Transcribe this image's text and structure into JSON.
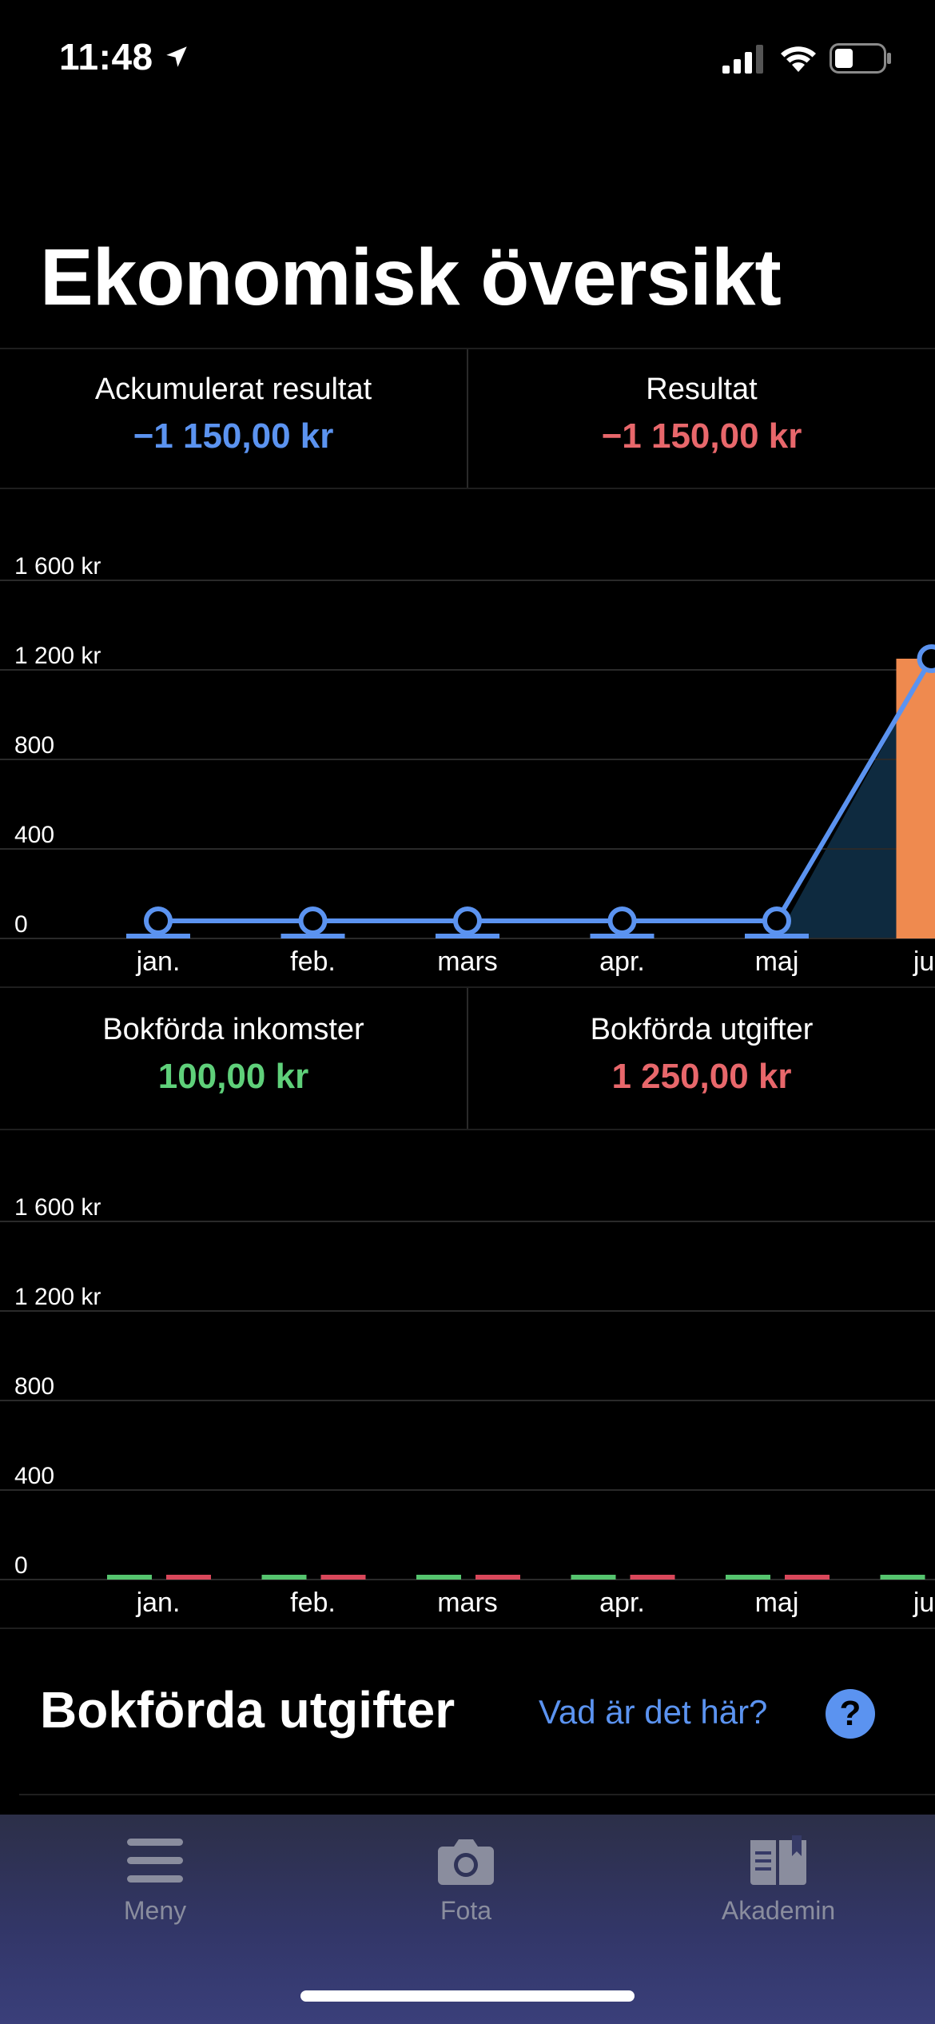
{
  "status_bar": {
    "time": "11:48",
    "icons": [
      "location-arrow-icon",
      "signal-icon",
      "wifi-icon",
      "battery-icon"
    ]
  },
  "page_title": "Ekonomisk översikt",
  "summary": {
    "accumulated_label": "Ackumulerat resultat",
    "accumulated_value": "−1 150,00 kr",
    "result_label": "Resultat",
    "result_value": "−1 150,00 kr"
  },
  "booked": {
    "income_label": "Bokförda inkomster",
    "income_value": "100,00 kr",
    "expenses_label": "Bokförda utgifter",
    "expenses_value": "1 250,00 kr"
  },
  "colors": {
    "accent_blue": "#5b93f0",
    "negative_red": "#e8676b",
    "positive_green": "#5fd07a",
    "bar_orange": "#ef8a4f",
    "expense_bar": "#d9475a",
    "income_bar": "#55c46e"
  },
  "chart_data": [
    {
      "type": "bar",
      "categories": [
        "jan.",
        "feb.",
        "mars",
        "apr.",
        "maj",
        "jun"
      ],
      "y_ticks": [
        "1 600 kr",
        "1 200 kr",
        "800",
        "400",
        "0"
      ],
      "ylim": [
        0,
        1600
      ],
      "series": [
        {
          "type": "bar",
          "values": [
            0,
            0,
            0,
            0,
            0,
            1250
          ]
        },
        {
          "type": "line",
          "values": [
            0,
            0,
            0,
            0,
            0,
            1250
          ]
        }
      ]
    },
    {
      "type": "bar",
      "categories": [
        "jan.",
        "feb.",
        "mars",
        "apr.",
        "maj",
        "jun"
      ],
      "y_ticks": [
        "1 600 kr",
        "1 200 kr",
        "800",
        "400",
        "0"
      ],
      "ylim": [
        0,
        1600
      ],
      "series": [
        {
          "values": [
            0,
            0,
            0,
            0,
            0,
            0
          ]
        },
        {
          "values": [
            0,
            0,
            0,
            0,
            0,
            0
          ]
        }
      ]
    }
  ],
  "section": {
    "title": "Bokförda utgifter",
    "help_link": "Vad är det här?",
    "help_icon_glyph": "?"
  },
  "tab_bar": {
    "items": [
      {
        "label": "Meny",
        "icon": "menu-icon"
      },
      {
        "label": "Fota",
        "icon": "camera-icon"
      },
      {
        "label": "Akademin",
        "icon": "book-icon"
      }
    ]
  }
}
